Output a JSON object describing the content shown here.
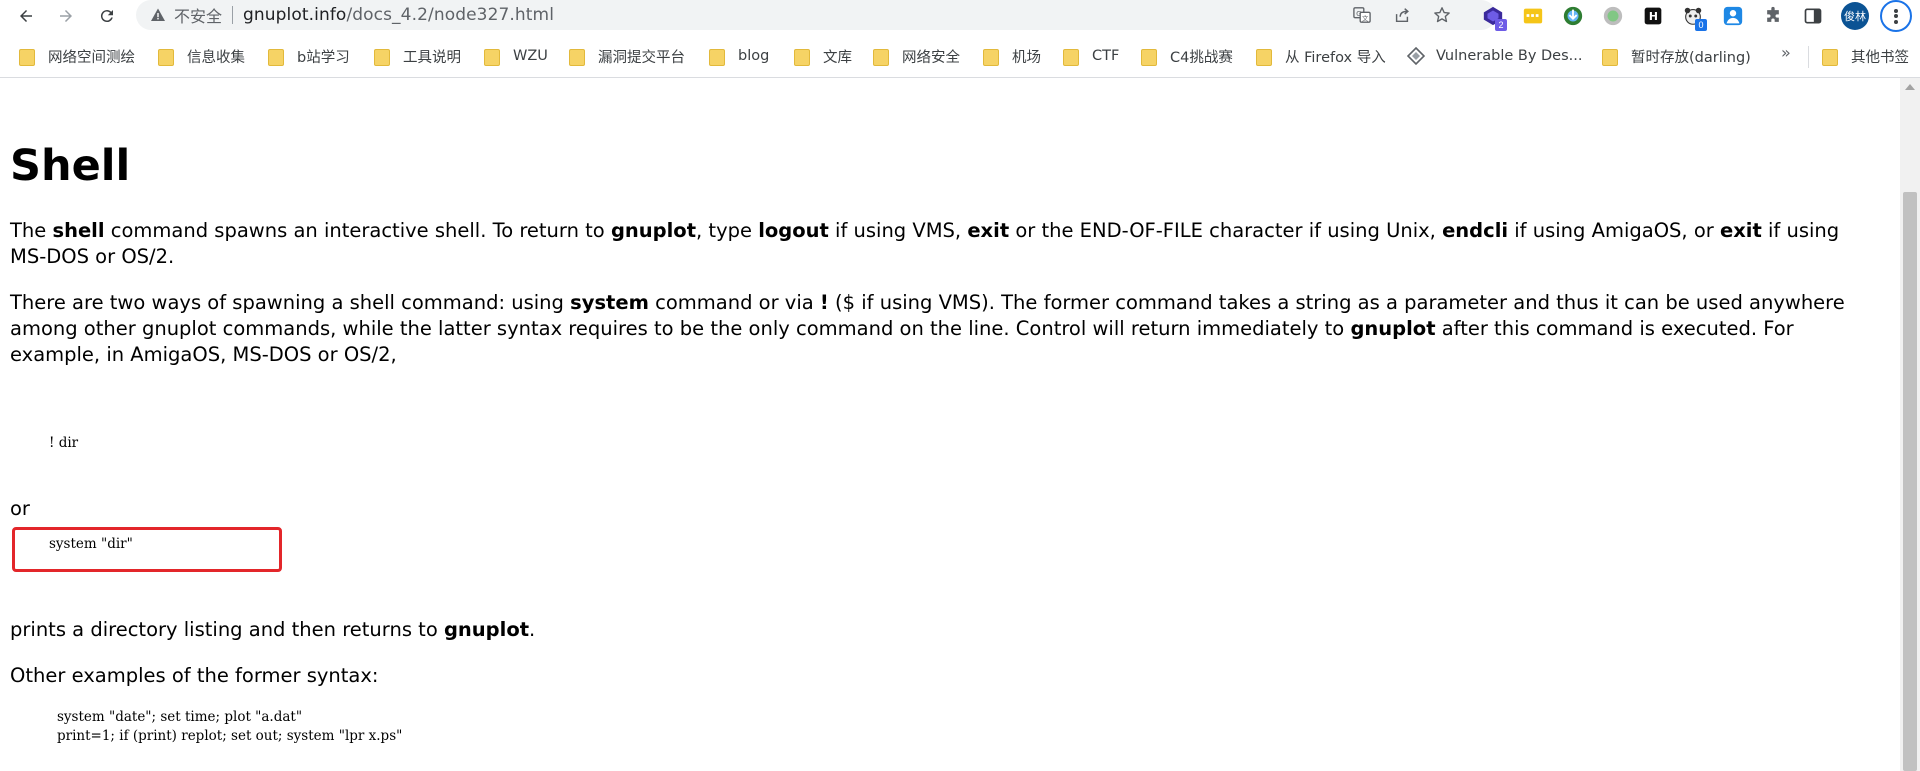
{
  "browser": {
    "security_label": "不安全",
    "url_host": "gnuplot.info",
    "url_path": "/docs_4.2/node327.html",
    "extensions": [
      {
        "name": "vpn-extension-icon",
        "badge": "2"
      },
      {
        "name": "notes-extension-icon",
        "badge": ""
      },
      {
        "name": "download-extension-icon",
        "badge": ""
      },
      {
        "name": "circle-extension-icon",
        "badge": ""
      },
      {
        "name": "h-extension-icon",
        "badge": ""
      },
      {
        "name": "panda-extension-icon",
        "badge": "0"
      },
      {
        "name": "person-extension-icon",
        "badge": ""
      }
    ],
    "avatar_text": "俊林"
  },
  "bookmarks": {
    "items": [
      {
        "label": "网络空间测绘"
      },
      {
        "label": "信息收集"
      },
      {
        "label": "b站学习"
      },
      {
        "label": "工具说明"
      },
      {
        "label": "WZU"
      },
      {
        "label": "漏洞提交平台"
      },
      {
        "label": "blog"
      },
      {
        "label": "文库"
      },
      {
        "label": "网络安全"
      },
      {
        "label": "机场"
      },
      {
        "label": "CTF"
      },
      {
        "label": "C4挑战赛"
      },
      {
        "label": "从 Firefox 导入"
      },
      {
        "label": "Vulnerable By Des..."
      },
      {
        "label": "暂时存放(darling)"
      }
    ],
    "more": "»",
    "other": "其他书签"
  },
  "content": {
    "title": "Shell",
    "p1": [
      {
        "t": "The ",
        "b": false
      },
      {
        "t": "shell",
        "b": true
      },
      {
        "t": " command spawns an interactive shell. To return to ",
        "b": false
      },
      {
        "t": "gnuplot",
        "b": true
      },
      {
        "t": ", type ",
        "b": false
      },
      {
        "t": "logout",
        "b": true
      },
      {
        "t": " if using VMS, ",
        "b": false
      },
      {
        "t": "exit",
        "b": true
      },
      {
        "t": " or the END-OF-FILE character if using Unix, ",
        "b": false
      },
      {
        "t": "endcli",
        "b": true
      },
      {
        "t": " if using AmigaOS, or ",
        "b": false
      },
      {
        "t": "exit",
        "b": true
      },
      {
        "t": " if using MS-DOS or OS/2.",
        "b": false
      }
    ],
    "p2": [
      {
        "t": "There are two ways of spawning a shell command: using ",
        "b": false
      },
      {
        "t": "system",
        "b": true
      },
      {
        "t": " command or via ",
        "b": false
      },
      {
        "t": "!",
        "b": true
      },
      {
        "t": " ($ if using VMS). The former command takes a string as a parameter and thus it can be used anywhere among other gnuplot commands, while the latter syntax requires to be the only command on the line. Control will return immediately to ",
        "b": false
      },
      {
        "t": "gnuplot",
        "b": true
      },
      {
        "t": " after this command is executed. For example, in AmigaOS, MS-DOS or OS/2,",
        "b": false
      }
    ],
    "code1": "! dir",
    "or_text": "or",
    "code2": "system \"dir\"",
    "p3": [
      {
        "t": "prints a directory listing and then returns to ",
        "b": false
      },
      {
        "t": "gnuplot",
        "b": true
      },
      {
        "t": ".",
        "b": false
      }
    ],
    "p4": "Other examples of the former syntax:",
    "code3_line1": "system \"date\"; set time; plot \"a.dat\"",
    "code3_line2": "print=1; if (print) replot; set out; system \"lpr x.ps\""
  },
  "colors": {
    "highlight": "#e3262a",
    "folder": "#f6d365"
  }
}
